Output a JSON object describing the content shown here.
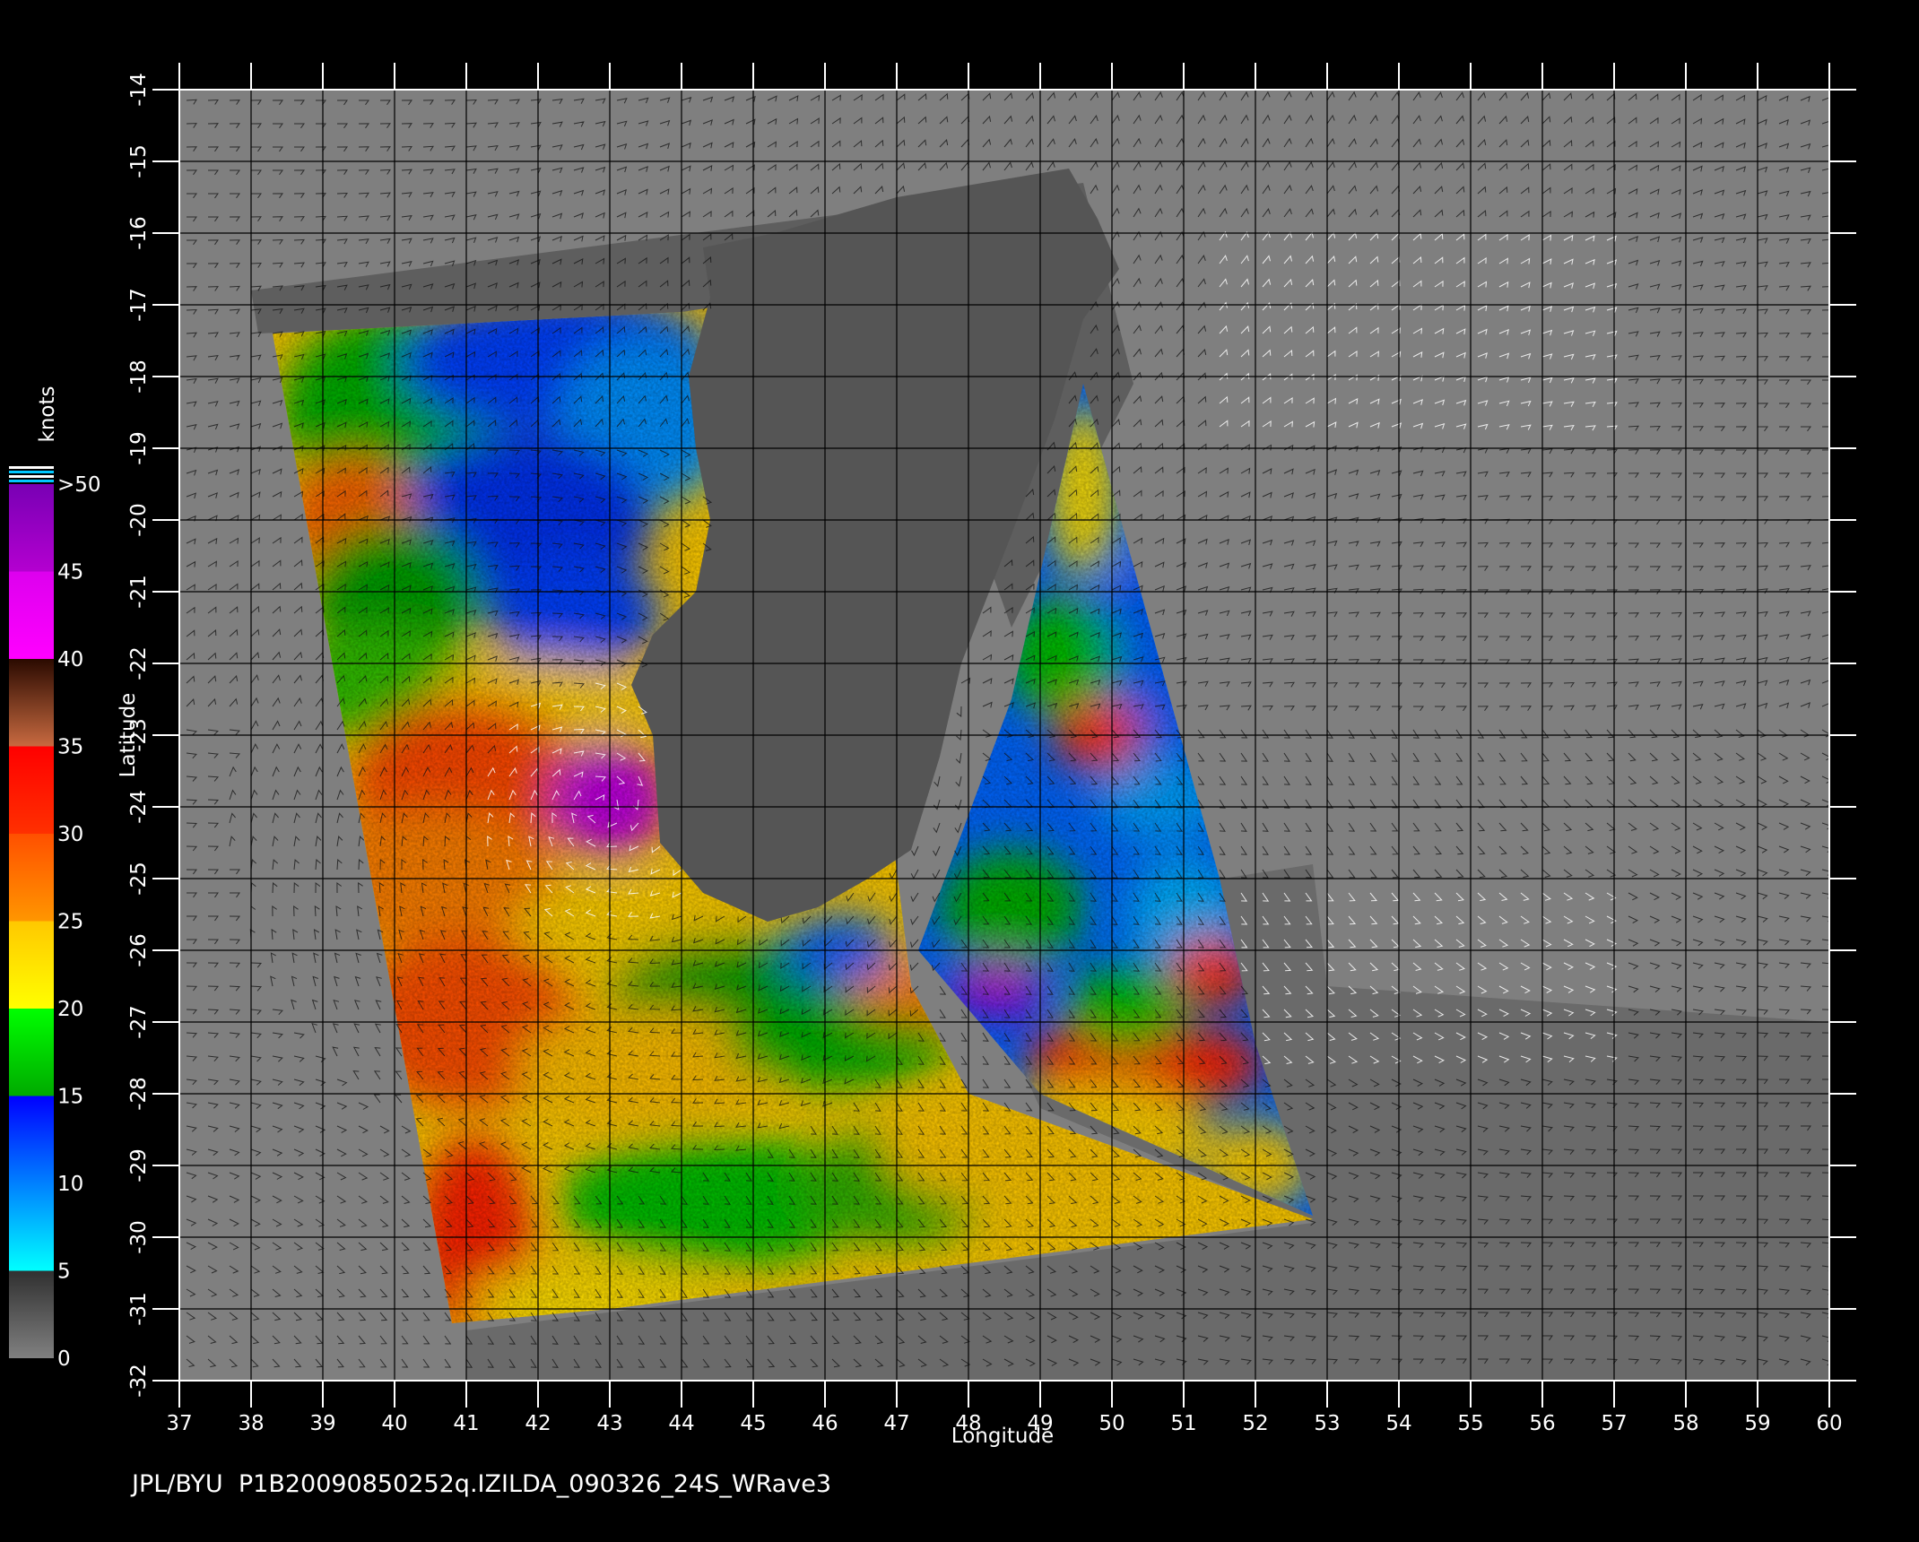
{
  "map": {
    "x_axis_label": "Longitude",
    "y_axis_label": "Latitude",
    "lon_range": [
      37,
      60
    ],
    "lat_range": [
      -32,
      -14
    ],
    "lon_ticks": [
      37,
      38,
      39,
      40,
      41,
      42,
      43,
      44,
      45,
      46,
      47,
      48,
      49,
      50,
      51,
      52,
      53,
      54,
      55,
      56,
      57,
      58,
      59,
      60
    ],
    "lat_ticks": [
      -14,
      -15,
      -16,
      -17,
      -18,
      -19,
      -20,
      -21,
      -22,
      -23,
      -24,
      -25,
      -26,
      -27,
      -28,
      -29,
      -30,
      -31,
      -32
    ],
    "lon_tick_labels": [
      "37",
      "38",
      "39",
      "40",
      "41",
      "42",
      "43",
      "44",
      "45",
      "46",
      "47",
      "48",
      "49",
      "50",
      "51",
      "52",
      "53",
      "54",
      "55",
      "56",
      "57",
      "58",
      "59",
      "60"
    ],
    "lat_tick_labels": [
      "-14",
      "-15",
      "-16",
      "-17",
      "-18",
      "-19",
      "-20",
      "-21",
      "-22",
      "-23",
      "-24",
      "-25",
      "-26",
      "-27",
      "-28",
      "-29",
      "-30",
      "-31",
      "-32"
    ],
    "grid": true,
    "background_color": "#7f7f7f",
    "land_color": "#555555",
    "feature": "cyclone-wind-field",
    "cyclone_center": [
      42.9,
      -24.0
    ]
  },
  "colorbar": {
    "unit": "knots",
    "labels": [
      ">50",
      "45",
      "40",
      "35",
      "30",
      "25",
      "20",
      "15",
      "10",
      "5",
      "0"
    ],
    "segments": [
      {
        "from": 0,
        "to": 5,
        "colors": [
          "#808080",
          "#303030"
        ]
      },
      {
        "from": 5,
        "to": 10,
        "colors": [
          "#00ffff",
          "#0080ff"
        ]
      },
      {
        "from": 10,
        "to": 15,
        "colors": [
          "#0080ff",
          "#0000ff"
        ]
      },
      {
        "from": 15,
        "to": 20,
        "colors": [
          "#00aa00",
          "#00ff00"
        ]
      },
      {
        "from": 20,
        "to": 25,
        "colors": [
          "#ffff00",
          "#ffc800"
        ]
      },
      {
        "from": 25,
        "to": 30,
        "colors": [
          "#ff9600",
          "#ff5000"
        ]
      },
      {
        "from": 30,
        "to": 35,
        "colors": [
          "#ff3000",
          "#ff0000"
        ]
      },
      {
        "from": 35,
        "to": 40,
        "colors": [
          "#c86a40",
          "#2a0a00"
        ]
      },
      {
        "from": 40,
        "to": 45,
        "colors": [
          "#ff00ff",
          "#dd00ee"
        ]
      },
      {
        "from": 45,
        "to": 50,
        "colors": [
          "#b400d0",
          "#7800b4"
        ]
      }
    ]
  },
  "footer": {
    "credit": "JPL/BYU",
    "product": "P1B20090850252q.IZILDA_090326_24S_WRave3"
  }
}
